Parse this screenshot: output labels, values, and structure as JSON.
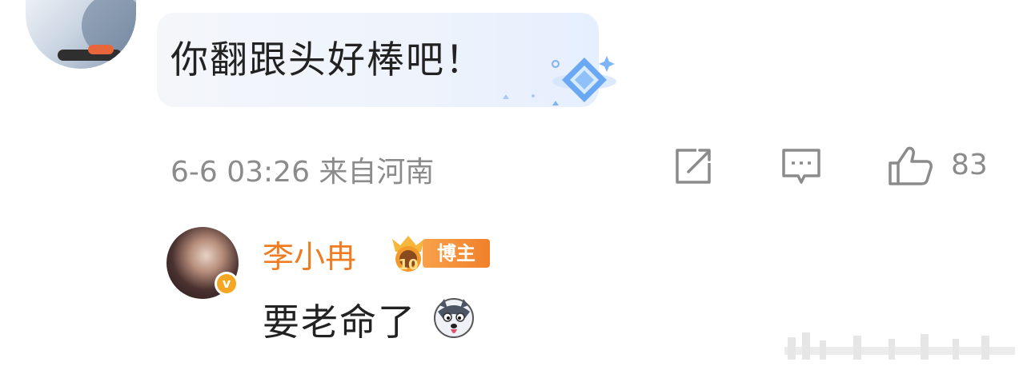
{
  "comment": {
    "text": "你翻跟头好棒吧！",
    "meta": "6-6 03:26 来自河南",
    "like_count": "83"
  },
  "reply": {
    "author": "李小冉",
    "tag": "博主",
    "crown_level": "10",
    "verified_mark": "v",
    "text": "要老命了"
  },
  "icons": [
    "share-icon",
    "comment-icon",
    "like-icon",
    "husky-emoji-icon",
    "blogger-crown-icon"
  ],
  "colors": {
    "name": "#ef7c21",
    "meta": "#8b8b8b",
    "tag_bg": "#f1802a",
    "bubble_bg": "#eef3fc"
  }
}
